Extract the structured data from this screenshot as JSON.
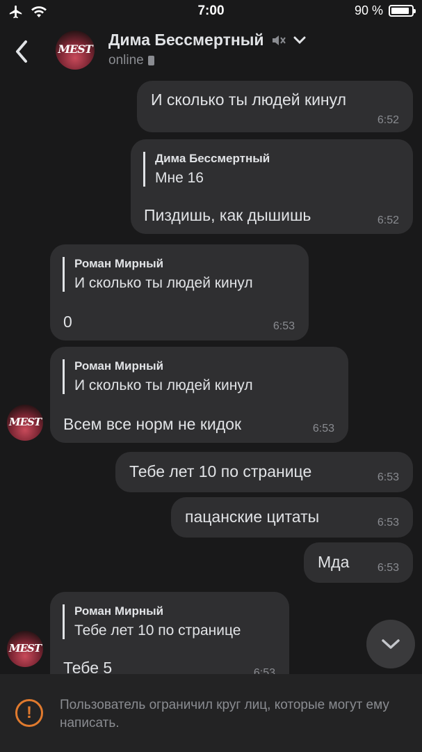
{
  "status_bar": {
    "time": "7:00",
    "battery": "90 %",
    "battery_level": 0.9
  },
  "header": {
    "back_icon": "chevron-left-icon",
    "name": "Дима Бессмертный",
    "status": "online",
    "avatar_text": "MEST"
  },
  "messages": [
    {
      "text": "И сколько ты людей кинул",
      "time": "6:52"
    },
    {
      "reply_author": "Дима Бессмертный",
      "reply_text": "Мне 16",
      "text": "Пиздишь, как дышишь",
      "time": "6:52"
    },
    {
      "reply_author": "Роман Мирный",
      "reply_text": "И сколько ты людей кинул",
      "text": "0",
      "time": "6:53"
    },
    {
      "reply_author": "Роман Мирный",
      "reply_text": "И сколько ты людей кинул",
      "text": "Всем все норм не кидок",
      "time": "6:53"
    },
    {
      "text": "Тебе лет 10 по странице",
      "time": "6:53"
    },
    {
      "text": "пацанские цитаты",
      "time": "6:53"
    },
    {
      "text": "Мда",
      "time": "6:53"
    },
    {
      "reply_author": "Роман Мирный",
      "reply_text": "Тебе лет 10 по странице",
      "text": "Тебе 5",
      "time": "6:53"
    }
  ],
  "notice": {
    "text": "Пользователь ограничил круг лиц, которые могут ему написать."
  }
}
